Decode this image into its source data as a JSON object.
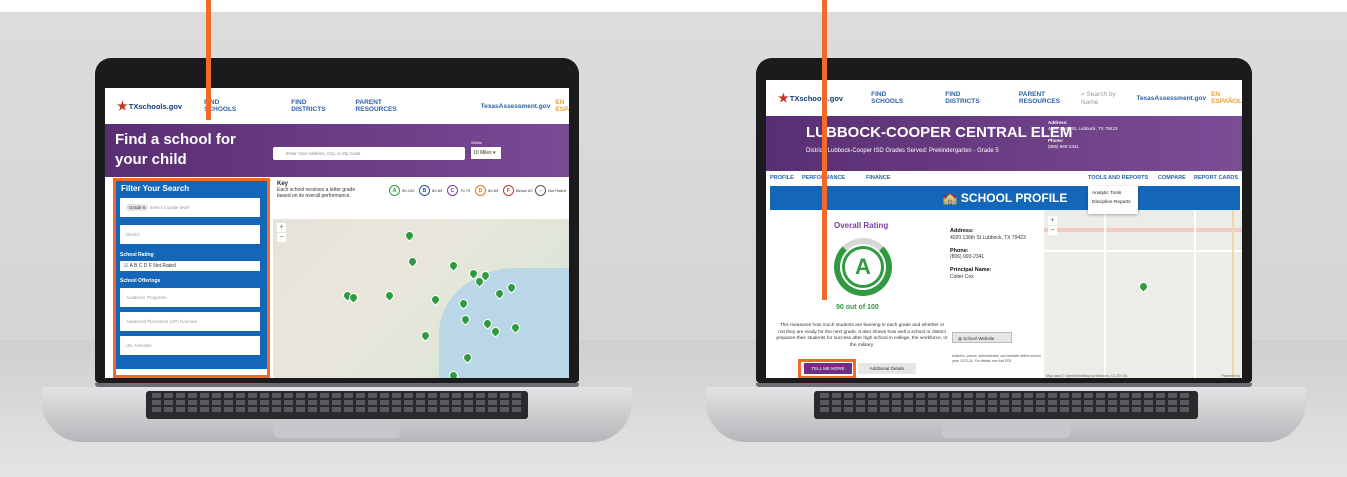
{
  "colors": {
    "accent": "#f26a2a",
    "purple": "#5a2e72",
    "blue": "#1466b8",
    "green": "#2f9a40"
  },
  "left_screen": {
    "logo": "TXschools.gov",
    "nav": [
      "FIND SCHOOLS",
      "FIND DISTRICTS",
      "PARENT RESOURCES"
    ],
    "nav_right": "TexasAssessment.gov",
    "lang": "EN ESPAÑOL",
    "hero_title": "Find a school for your child",
    "search_placeholder": "Enter Your Address, City, or Zip Code",
    "within_label": "Within",
    "within_value": "10 Miles",
    "filter": {
      "title": "Filter Your Search",
      "grade_chip": "Grade 5",
      "grade_placeholder": "Select a grade level",
      "district_placeholder": "District",
      "rating_label": "School Rating",
      "rating_options": "A   B   C   D   F   Not Rated",
      "offerings_label": "School Offerings",
      "offerings": [
        "Academic Programs",
        "Advanced Placement (AP) Courses",
        "UIL Activities"
      ]
    },
    "key": {
      "title": "Key",
      "description": "Each school receives a letter grade based on its overall performance.",
      "items": [
        {
          "grade": "A",
          "range": "90-100",
          "color": "#2f9a40"
        },
        {
          "grade": "B",
          "range": "80-89",
          "color": "#2c4fa8"
        },
        {
          "grade": "C",
          "range": "70-79",
          "color": "#7b3f98"
        },
        {
          "grade": "D",
          "range": "60-69",
          "color": "#e0761c"
        },
        {
          "grade": "F",
          "range": "Below 60",
          "color": "#c0392b"
        },
        {
          "grade": "-",
          "range": "Not Rated",
          "color": "#555555"
        }
      ]
    }
  },
  "right_screen": {
    "logo": "TXschools.gov",
    "nav": [
      "FIND SCHOOLS",
      "FIND DISTRICTS",
      "PARENT RESOURCES"
    ],
    "search_placeholder": "Search by Name",
    "nav_right": "TexasAssessment.gov",
    "lang": "EN ESPAÑOL",
    "school_name": "LUBBOCK-COOPER CENTRAL ELEM",
    "district_line": "District: Lubbock-Cooper ISD    Grades Served: Prekindergarten - Grade 5",
    "address_header": "Address:",
    "address_header_value": "4020 136th St, Lubbock, TX 79423",
    "phone_header": "Phone:",
    "phone_header_value": "(806) 993-2341",
    "tabs": [
      "PROFILE",
      "PERFORMANCE",
      "FINANCE"
    ],
    "tabs_right": [
      "TOOLS AND REPORTS",
      "COMPARE",
      "REPORT CARDS"
    ],
    "dropdown": [
      "Analytic Tools",
      "Discipline Reports"
    ],
    "banner": "SCHOOL PROFILE",
    "overall_label": "Overall Rating",
    "grade": "A",
    "score": "90 out of 100",
    "measure_text": "This measures how much students are learning in each grade and whether or not they are ready for the next grade. It also shows how well a school or district prepares their students for success after high school in college, the workforce, or the military.",
    "btn_more": "TELL ME MORE",
    "btn_add": "Additional Details",
    "address_label": "Address:",
    "address_value": "4020 136th St Lubbock, TX 79423",
    "phone_label": "Phone:",
    "phone_value": "(806) 993-2341",
    "principal_label": "Principal Name:",
    "principal_value": "Colter Cox",
    "website_btn": "School Website",
    "note": "Address, phone, administrator, and website reflect school year 2023-24. For details see AskTED.",
    "map_credit": "Map data © OpenStreetMap contributors, CC-BY-SA",
    "powered": "Powered by"
  }
}
